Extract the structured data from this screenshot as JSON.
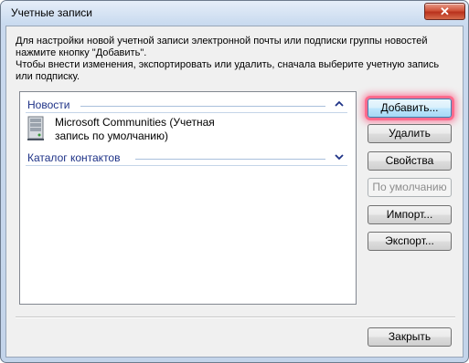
{
  "window": {
    "title": "Учетные записи",
    "close_symbol": "✕"
  },
  "intro": {
    "line1": "Для настройки новой учетной записи электронной почты или подписки группы новостей",
    "line2": "нажмите кнопку \"Добавить\".",
    "line3": "Чтобы внести изменения, экспортировать или удалить, сначала выберите учетную запись",
    "line4": "или подписку."
  },
  "groups": [
    {
      "label": "Новости",
      "chevron": "up"
    },
    {
      "label": "Каталог контактов",
      "chevron": "down"
    }
  ],
  "account": {
    "line1": "Microsoft Communities (Учетная",
    "line2": "запись по умолчанию)",
    "icon": "server-icon"
  },
  "buttons": {
    "add": "Добавить...",
    "delete": "Удалить",
    "properties": "Свойства",
    "default": "По умолчанию",
    "import": "Импорт...",
    "export": "Экспорт...",
    "close": "Закрыть"
  },
  "colors": {
    "group_header_text": "#1e3287",
    "focus_glow": "#ff6b8d"
  }
}
